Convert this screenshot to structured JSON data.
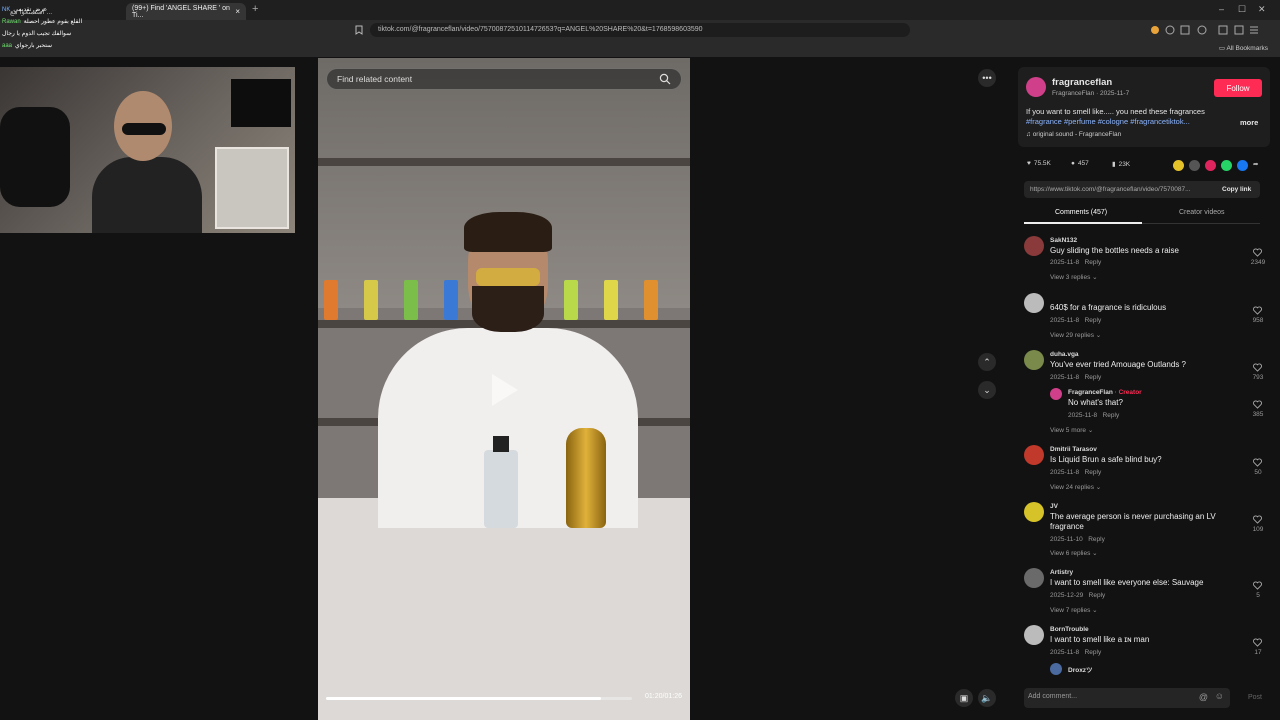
{
  "browser": {
    "tabs": [
      {
        "label": "استمتعوا مع ..."
      },
      {
        "label": "(99+) Find 'ANGEL SHARE ' on Ti...",
        "close": "×"
      }
    ],
    "new_tab": "+",
    "url": "tiktok.com/@fragranceflan/video/7570087251011472653?q=ANGEL%20SHARE%20&t=1768598603590",
    "bookmarks_label": "All Bookmarks",
    "window_controls": [
      "–",
      "☐",
      "✕"
    ]
  },
  "stream_chat": {
    "lines": [
      {
        "user": "NK",
        "text": "عرض تقديمي"
      },
      {
        "user": "Rawan",
        "text": "القلع بقوم عطور احصلة"
      },
      {
        "user": "",
        "text": "سوالفك تجيب الدوم يا رجال"
      },
      {
        "user": "aaa",
        "text": "ستحبر بارجواي"
      }
    ]
  },
  "video": {
    "search_placeholder": "Find related content",
    "time": "01:20/01:26",
    "progress": 0.9,
    "cans": [
      "#e07a2e",
      "#d6c94a",
      "#7bbf4a",
      "#3a7ad6",
      "#e07a2e",
      "#4a8fd6",
      "#b9d84a",
      "#e0d64a",
      "#e0902e"
    ]
  },
  "post": {
    "author": "fragranceflan",
    "subtitle": "FragranceFlan · 2025-11-7",
    "follow_label": "Follow",
    "caption": "If you want to smell like..... you need these fragrances",
    "hashtags": "#fragrance #perfume #cologne #fragrancetiktok...",
    "more_label": "more",
    "sound": "original sound - FragranceFlan",
    "likes": "75.5K",
    "comments": "457",
    "saves": "23K",
    "share_colors": [
      "#e6c229",
      "#555555",
      "#e0245e",
      "#25d366",
      "#1877f2"
    ],
    "link": "https://www.tiktok.com/@fragranceflan/video/7570087...",
    "copy_link_label": "Copy link",
    "tab_comments": "Comments (457)",
    "tab_creator": "Creator videos"
  },
  "comments": [
    {
      "user": "SakN132",
      "text": "Guy sliding the bottles needs a raise",
      "date": "2025-11-8",
      "reply": "Reply",
      "likes": "2349",
      "replies": "View 3 replies",
      "avatar_color": "#8a3a3a"
    },
    {
      "user": "",
      "text": "640$ for a fragrance is ridiculous",
      "date": "2025-11-8",
      "reply": "Reply",
      "likes": "958",
      "replies": "View 29 replies",
      "avatar_color": "#bbbbbb"
    },
    {
      "user": "duha.vga",
      "text": "You've ever tried Amouage Outlands ?",
      "date": "2025-11-8",
      "reply": "Reply",
      "likes": "793",
      "replies": "View 5 more",
      "avatar_color": "#7a8a4a",
      "sub": {
        "user": "FragranceFlan",
        "tag": "· Creator",
        "text": "No what's that?",
        "date": "2025-11-8",
        "reply": "Reply",
        "likes": "385"
      }
    },
    {
      "user": "Dmitrii Tarasov",
      "text": "Is Liquid Brun a safe blind buy?",
      "date": "2025-11-8",
      "reply": "Reply",
      "likes": "50",
      "replies": "View 24 replies",
      "avatar_color": "#c0392b"
    },
    {
      "user": "JV",
      "text": "The average person is never purchasing an LV",
      "text2": "fragrance",
      "date": "2025-11-10",
      "reply": "Reply",
      "likes": "109",
      "replies": "View 6 replies",
      "avatar_color": "#d6c229"
    },
    {
      "user": "Artistry",
      "text": "I want to smell like everyone else: Sauvage",
      "date": "2025-12-29",
      "reply": "Reply",
      "likes": "5",
      "replies": "View 7 replies",
      "avatar_color": "#6a6a6a"
    },
    {
      "user": "BornTrouble",
      "text": "I want to smell like a ɪɴ man",
      "date": "2025-11-8",
      "reply": "Reply",
      "likes": "17",
      "replies": "",
      "avatar_color": "#bbbbbb"
    }
  ],
  "last_partial": {
    "user": "Droxzツ"
  },
  "add_comment": {
    "placeholder": "Add comment...",
    "post_label": "Post"
  }
}
